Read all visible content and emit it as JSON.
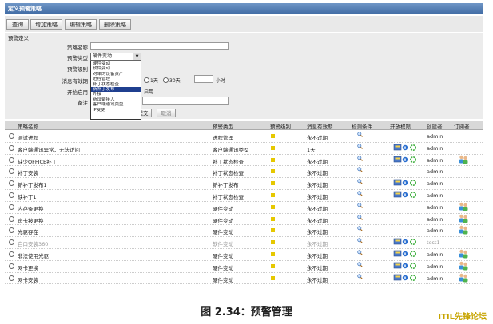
{
  "window": {
    "title": "定义预警策略"
  },
  "toolbar": {
    "query": "查询",
    "add": "增加策略",
    "edit": "编辑策略",
    "delete": "删除策略"
  },
  "form": {
    "section": "预警定义",
    "name_label": "策略名称",
    "type_label": "预警类型",
    "type_value": "硬件变动",
    "level_label": "预警级别",
    "valid_label": "消息有效期",
    "valid_opt1": "1天",
    "valid_opt2": "30天",
    "valid_unit": "小时",
    "enable_label": "开始启用",
    "enable_text": "启用",
    "remark_label": "备注",
    "submit": "提交",
    "cancel": "取消",
    "type_options": [
      "硬件变动",
      "软件变动",
      "对单的设备资产",
      "进程管理",
      "补丁状态检查",
      "新补丁发布",
      "外接",
      "新设备接入",
      "客户端通讯类型",
      "IP变更"
    ],
    "type_selected_index": 5
  },
  "table": {
    "headers": [
      "策略名称",
      "预警类型",
      "预警级别",
      "消息有效期",
      "检测条件",
      "开放权限",
      "创建者",
      "订阅者"
    ],
    "rows": [
      {
        "name": "测试进程",
        "type": "进程管理",
        "valid": "永不过期",
        "ops": false,
        "creator": "admin",
        "sub": false,
        "gray": false
      },
      {
        "name": "客户端通讯异常，无法访问",
        "type": "客户端通讯类型",
        "valid": "1天",
        "ops": true,
        "creator": "admin",
        "sub": false,
        "gray": false
      },
      {
        "name": "缺少OFFICE补丁",
        "type": "补丁状态检查",
        "valid": "永不过期",
        "ops": true,
        "creator": "admin",
        "sub": true,
        "gray": false
      },
      {
        "name": "补丁安装",
        "type": "补丁状态检查",
        "valid": "永不过期",
        "ops": false,
        "creator": "admin",
        "sub": false,
        "gray": false
      },
      {
        "name": "新补丁发布1",
        "type": "新补丁发布",
        "valid": "永不过期",
        "ops": true,
        "creator": "admin",
        "sub": false,
        "gray": false
      },
      {
        "name": "缺补丁1",
        "type": "补丁状态检查",
        "valid": "永不过期",
        "ops": true,
        "creator": "admin",
        "sub": false,
        "gray": false
      },
      {
        "name": "内存条更换",
        "type": "硬件变动",
        "valid": "永不过期",
        "ops": false,
        "creator": "admin",
        "sub": true,
        "gray": false
      },
      {
        "name": "声卡被更换",
        "type": "硬件变动",
        "valid": "永不过期",
        "ops": false,
        "creator": "admin",
        "sub": true,
        "gray": false
      },
      {
        "name": "光驱存在",
        "type": "硬件变动",
        "valid": "永不过期",
        "ops": false,
        "creator": "admin",
        "sub": true,
        "gray": false
      },
      {
        "name": "白口安装360",
        "type": "软件变动",
        "valid": "永不过期",
        "ops": true,
        "creator": "test1",
        "sub": false,
        "gray": true
      },
      {
        "name": "非法使用光驱",
        "type": "硬件变动",
        "valid": "永不过期",
        "ops": true,
        "creator": "admin",
        "sub": true,
        "gray": false
      },
      {
        "name": "网卡更换",
        "type": "硬件变动",
        "valid": "永不过期",
        "ops": true,
        "creator": "admin",
        "sub": true,
        "gray": false
      },
      {
        "name": "网卡安装",
        "type": "硬件变动",
        "valid": "永不过期",
        "ops": true,
        "creator": "admin",
        "sub": true,
        "gray": false
      }
    ]
  },
  "caption": "图 2.34：预警管理",
  "watermark": {
    "prefix": "ITIL",
    "suffix": "先锋论坛"
  }
}
